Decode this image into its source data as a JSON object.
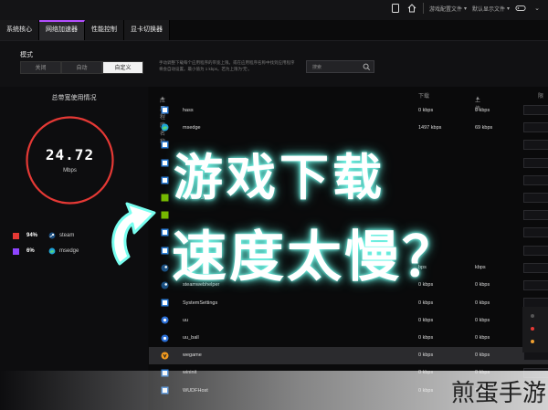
{
  "tabs": [
    "系统核心",
    "网络加速器",
    "性能控制",
    "显卡切换器"
  ],
  "top_bar": {
    "dropdown1": "游戏配置文件",
    "dropdown2": "默认显示文件"
  },
  "mode": {
    "title": "模式",
    "options": [
      "关闭",
      "自动",
      "自定义"
    ],
    "description": "手动调整下载每个应用程序的带宽上限。或在应用程序名称中找到应用程序将会自动设置。最小值为 1 kbps。若为上限为'无'。",
    "search_placeholder": "搜索"
  },
  "bandwidth": {
    "title": "总带宽使用情况",
    "value": "24.72",
    "unit": "Mbps",
    "legend": [
      {
        "pct": "94%",
        "name": "steam",
        "color": "#e53935"
      },
      {
        "pct": "6%",
        "name": "msedge",
        "color": "#8e44ff"
      }
    ]
  },
  "table": {
    "col_name": "应用程序名称",
    "col_down": "下载",
    "col_up": "上传",
    "col_limit": "限",
    "rows": [
      {
        "name": "hass",
        "down": "0 kbps",
        "up": "0 kbps",
        "icon": "app-icon"
      },
      {
        "name": "msedge",
        "down": "1497 kbps",
        "up": "69 kbps",
        "icon": "edge-icon"
      },
      {
        "name": "",
        "down": "",
        "up": "",
        "icon": "app-icon"
      },
      {
        "name": "",
        "down": "",
        "up": "",
        "icon": "app-icon"
      },
      {
        "name": "",
        "down": "",
        "up": "",
        "icon": "app-icon"
      },
      {
        "name": "NVIDIA Share",
        "down": "",
        "up": "",
        "icon": "nvidia-icon"
      },
      {
        "name": "",
        "down": "",
        "up": "",
        "icon": "nvidia-icon"
      },
      {
        "name": "",
        "down": "",
        "up": "",
        "icon": "app-icon"
      },
      {
        "name": "",
        "down": "",
        "up": "",
        "icon": "app-icon"
      },
      {
        "name": "",
        "down": "bps",
        "up": "kbps",
        "icon": "steam-icon"
      },
      {
        "name": "steamwebhelper",
        "down": "0 kbps",
        "up": "0 kbps",
        "icon": "steam-icon"
      },
      {
        "name": "SystemSettings",
        "down": "0 kbps",
        "up": "0 kbps",
        "icon": "app-icon"
      },
      {
        "name": "uu",
        "down": "0 kbps",
        "up": "0 kbps",
        "icon": "uu-icon"
      },
      {
        "name": "uu_ball",
        "down": "0 kbps",
        "up": "0 kbps",
        "icon": "uu-icon"
      },
      {
        "name": "wegame",
        "down": "0 kbps",
        "up": "0 kbps",
        "icon": "wegame-icon"
      },
      {
        "name": "wininit",
        "down": "0 kbps",
        "up": "0 kbps",
        "icon": "app-icon"
      },
      {
        "name": "WUDFHost",
        "down": "0 kbps",
        "up": "0 kbps",
        "icon": "app-icon"
      }
    ]
  },
  "overlay": {
    "line1": "游戏下载",
    "line2": "速度太慢？"
  },
  "watermark": "煎蛋手游",
  "colors": {
    "accent": "#b34eff",
    "gauge_ring": "#e53935",
    "overlay_glow": "#78fff0"
  }
}
